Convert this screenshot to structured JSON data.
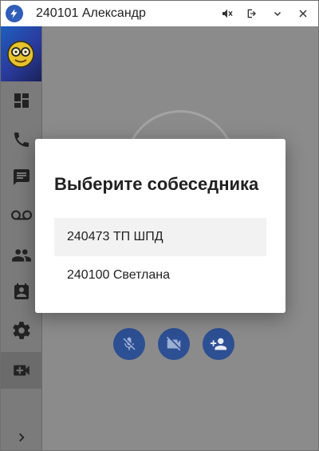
{
  "window": {
    "title": "240101 Александр"
  },
  "titlebar_icons": [
    "app-logo-icon",
    "mute-notifications-icon",
    "logout-icon",
    "chevron-down-icon",
    "close-icon"
  ],
  "sidebar": {
    "items": [
      {
        "name": "dashboard",
        "icon": "dashboard-icon"
      },
      {
        "name": "calls",
        "icon": "phone-icon"
      },
      {
        "name": "chat",
        "icon": "chat-icon"
      },
      {
        "name": "voicemail",
        "icon": "voicemail-icon"
      },
      {
        "name": "contacts",
        "icon": "contacts-icon"
      },
      {
        "name": "contact-card",
        "icon": "contact-card-icon"
      },
      {
        "name": "settings",
        "icon": "gear-icon"
      },
      {
        "name": "video-call",
        "icon": "video-call-icon",
        "active": true
      }
    ],
    "expand_icon": "chevron-right-icon"
  },
  "call_controls": [
    "mic-off-icon",
    "video-off-icon",
    "add-person-icon"
  ],
  "dialog": {
    "title": "Выберите собеседника",
    "options": [
      "240473 ТП ШПД",
      "240100 Светлана"
    ]
  },
  "colors": {
    "accent": "#2d4f93",
    "overlay": "#8b8b8b",
    "dialog_bg": "#ffffff",
    "selected_option": "#f2f2f2"
  }
}
